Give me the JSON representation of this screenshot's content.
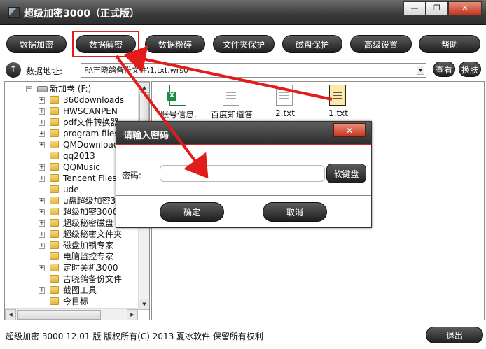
{
  "window": {
    "title": "超级加密3000（正式版）",
    "minimize_glyph": "—",
    "restore_glyph": "❐",
    "close_glyph": "✕"
  },
  "toolbar": {
    "buttons": [
      {
        "label": "数据加密"
      },
      {
        "label": "数据解密"
      },
      {
        "label": "数据粉碎"
      },
      {
        "label": "文件夹保护"
      },
      {
        "label": "磁盘保护"
      },
      {
        "label": "高级设置"
      },
      {
        "label": "帮助"
      }
    ],
    "highlighted": "数据解密",
    "highlight_color": "#e21b1b"
  },
  "address": {
    "up_glyph": "↑",
    "label": "数据地址:",
    "value": "F:\\吉晓鸽备份文件\\1.txt.wrs0",
    "view_button": "查看",
    "skin_button": "换肤"
  },
  "tree": {
    "drive": "新加卷 (F:)",
    "items": [
      {
        "label": "360downloads",
        "expandable": true
      },
      {
        "label": "HWSCANPEN",
        "expandable": true
      },
      {
        "label": "pdf文件转换器",
        "expandable": true
      },
      {
        "label": "program files",
        "expandable": true
      },
      {
        "label": "QMDownload",
        "expandable": true
      },
      {
        "label": "qq2013",
        "expandable": false
      },
      {
        "label": "QQMusic",
        "expandable": true
      },
      {
        "label": "Tencent Files",
        "expandable": true
      },
      {
        "label": "ude",
        "expandable": false
      },
      {
        "label": "u盘超级加密3",
        "expandable": true
      },
      {
        "label": "超级加密3000",
        "expandable": true
      },
      {
        "label": "超级秘密磁盘",
        "expandable": true
      },
      {
        "label": "超级秘密文件夹",
        "expandable": true
      },
      {
        "label": "磁盘加锁专家",
        "expandable": true
      },
      {
        "label": "电脑监控专家",
        "expandable": false
      },
      {
        "label": "定时关机3000",
        "expandable": true
      },
      {
        "label": "吉晓鸽备份文件",
        "expandable": false
      },
      {
        "label": "截图工具",
        "expandable": true
      },
      {
        "label": "今目标",
        "expandable": false
      }
    ]
  },
  "files": [
    {
      "name": "账号信息.",
      "icon": "excel-file-icon"
    },
    {
      "name": "百度知道答",
      "icon": "document-file-icon"
    },
    {
      "name": "2.txt",
      "icon": "text-file-icon"
    },
    {
      "name": "1.txt",
      "icon": "text-file-icon",
      "selected": true
    }
  ],
  "dialog": {
    "title": "请输入密码",
    "close_glyph": "✕",
    "password_label": "密码:",
    "password_value": "",
    "keyboard_button": "软键盘",
    "ok_button": "确定",
    "cancel_button": "取消"
  },
  "status": {
    "text": "超级加密 3000   12.01 版    版权所有(C)  2013 夏冰软件   保留所有权利",
    "exit_button": "退出"
  },
  "colors": {
    "annotation_red": "#e21b1b",
    "button_dark": "#1e1e1e",
    "titlebar": "#3a3a3a"
  }
}
